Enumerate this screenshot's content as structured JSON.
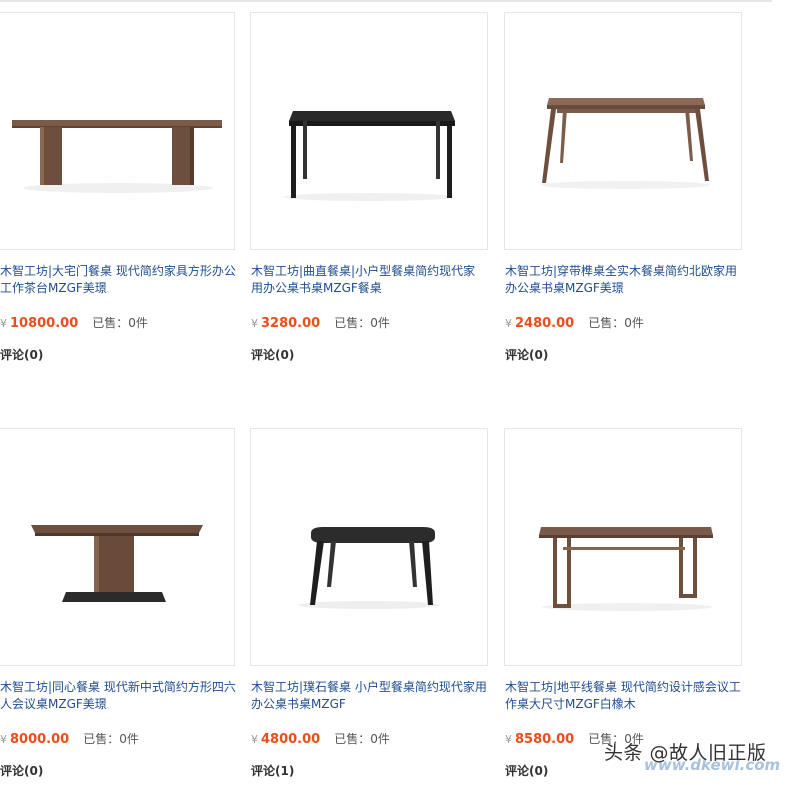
{
  "colors": {
    "title_link": "#1f4d8e",
    "price": "#e94e1b",
    "border": "#e6e6e6"
  },
  "products": [
    {
      "title": "木智工坊|大宅门餐桌 现代简约家具方形办公工作茶台MZGF美璟",
      "currency": "¥",
      "price": "10800.00",
      "sold_label": "已售：",
      "sold_count": "0件",
      "comments": "评论(0)",
      "image": "walnut-long-table-slab-legs"
    },
    {
      "title": "木智工坊|曲直餐桌|小户型餐桌简约现代家用办公桌书桌MZGF餐桌",
      "currency": "¥",
      "price": "3280.00",
      "sold_label": "已售：",
      "sold_count": "0件",
      "comments": "评论(0)",
      "image": "black-table"
    },
    {
      "title": "木智工坊|穿带榫桌全实木餐桌简约北欧家用办公桌书桌MZGF美璟",
      "currency": "¥",
      "price": "2480.00",
      "sold_label": "已售：",
      "sold_count": "0件",
      "comments": "评论(0)",
      "image": "walnut-splayed-leg-table"
    },
    {
      "title": "木智工坊|同心餐桌 现代新中式简约方形四六人会议桌MZGF美璟",
      "currency": "¥",
      "price": "8000.00",
      "sold_label": "已售：",
      "sold_count": "0件",
      "comments": "评论(0)",
      "image": "pedestal-table"
    },
    {
      "title": "木智工坊|璞石餐桌 小户型餐桌简约现代家用办公桌书桌MZGF",
      "currency": "¥",
      "price": "4800.00",
      "sold_label": "已售：",
      "sold_count": "0件",
      "comments": "评论(1)",
      "image": "black-oval-table"
    },
    {
      "title": "木智工坊|地平线餐桌 现代简约设计感会议工作桌大尺寸MZGF白橡木",
      "currency": "¥",
      "price": "8580.00",
      "sold_label": "已售：",
      "sold_count": "0件",
      "comments": "评论(0)",
      "image": "walnut-frame-table"
    }
  ],
  "watermark": {
    "main": "头条 @故人旧正版",
    "sub": "www.dkewl.com"
  }
}
